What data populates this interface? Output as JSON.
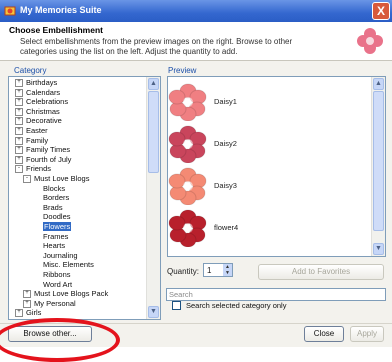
{
  "window": {
    "title": "My Memories Suite",
    "close_glyph": "X",
    "title_icon": "app-icon"
  },
  "header": {
    "title": "Choose Embellishment",
    "description": "Select embellishments from the preview images on the right. Browse to other categories using the list on the left. Adjust the quantity to add.",
    "icon": "flower-icon"
  },
  "category": {
    "label": "Category",
    "tree": [
      {
        "label": "Birthdays",
        "level": 1,
        "expander": "+"
      },
      {
        "label": "Calendars",
        "level": 1,
        "expander": "+"
      },
      {
        "label": "Celebrations",
        "level": 1,
        "expander": "+"
      },
      {
        "label": "Christmas",
        "level": 1,
        "expander": "+"
      },
      {
        "label": "Decorative",
        "level": 1,
        "expander": "+"
      },
      {
        "label": "Easter",
        "level": 1,
        "expander": "+"
      },
      {
        "label": "Family",
        "level": 1,
        "expander": "+"
      },
      {
        "label": "Family Times",
        "level": 1,
        "expander": "+"
      },
      {
        "label": "Fourth of July",
        "level": 1,
        "expander": "+"
      },
      {
        "label": "Friends",
        "level": 1,
        "expander": "-"
      },
      {
        "label": "Must Love Blogs",
        "level": 2,
        "expander": "-"
      },
      {
        "label": "Blocks",
        "level": 3
      },
      {
        "label": "Borders",
        "level": 3
      },
      {
        "label": "Brads",
        "level": 3
      },
      {
        "label": "Doodles",
        "level": 3
      },
      {
        "label": "Flowers",
        "level": 3,
        "selected": true
      },
      {
        "label": "Frames",
        "level": 3
      },
      {
        "label": "Hearts",
        "level": 3
      },
      {
        "label": "Journaling",
        "level": 3
      },
      {
        "label": "Misc. Elements",
        "level": 3
      },
      {
        "label": "Ribbons",
        "level": 3
      },
      {
        "label": "Word Art",
        "level": 3
      },
      {
        "label": "Must Love Blogs Pack",
        "level": 2,
        "expander": "+"
      },
      {
        "label": "My Personal",
        "level": 2,
        "expander": "+"
      },
      {
        "label": "Girls",
        "level": 1,
        "expander": "+"
      }
    ]
  },
  "preview": {
    "label": "Preview",
    "items": [
      {
        "name": "Daisy1",
        "color": "#f07f82"
      },
      {
        "name": "Daisy2",
        "color": "#c9455c"
      },
      {
        "name": "Daisy3",
        "color": "#f48a74"
      },
      {
        "name": "flower4",
        "color": "#b8202c"
      }
    ]
  },
  "quantity": {
    "label": "Quantity:",
    "value": "1"
  },
  "buttons": {
    "add_to_favorites": "Add to Favorites",
    "browse_other": "Browse other...",
    "close": "Close",
    "apply": "Apply"
  },
  "search": {
    "placeholder": "Search",
    "selected_only_label": "Search selected category only",
    "selected_only_checked": false
  },
  "colors": {
    "accent": "#316ac5",
    "titlebar": "#3467cf",
    "annotation_ring": "#e4131c"
  }
}
